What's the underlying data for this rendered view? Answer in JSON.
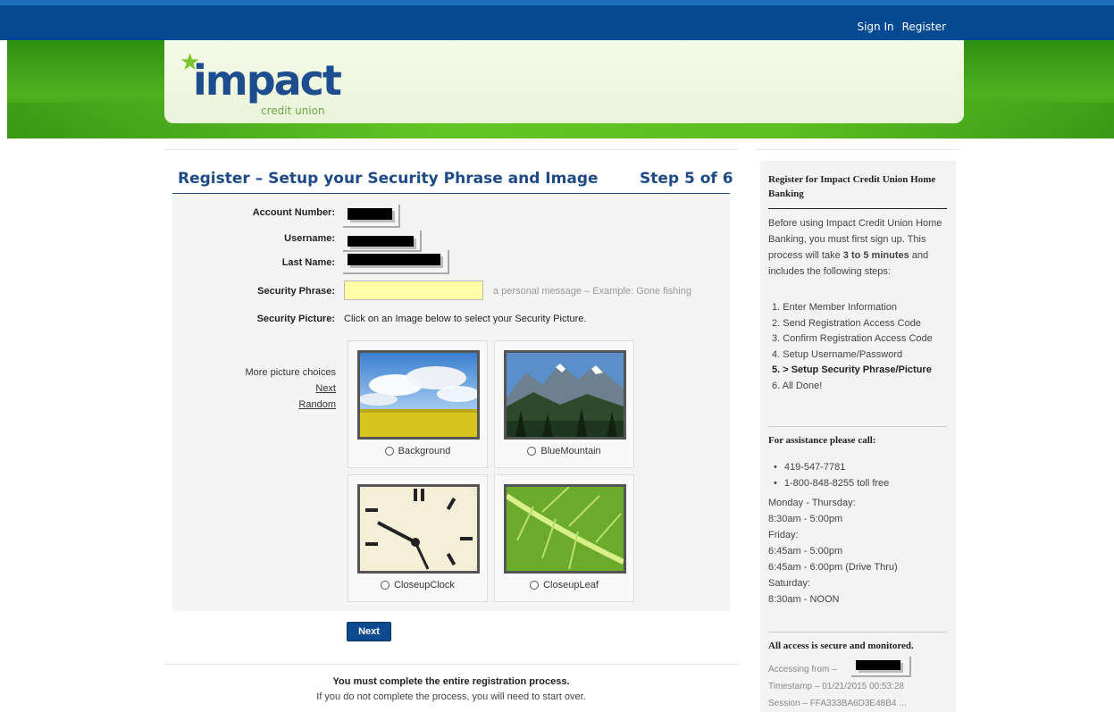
{
  "topnav": {
    "sign_in": "Sign In",
    "register": "Register"
  },
  "logo": {
    "main": "impact",
    "sub": "credit union"
  },
  "page": {
    "heading": "Register – Setup your Security Phrase and Image",
    "step": "Step 5 of 6"
  },
  "form": {
    "account_label": "Account Number:",
    "username_label": "Username:",
    "lastname_label": "Last Name:",
    "phrase_label": "Security Phrase:",
    "phrase_value": "",
    "phrase_hint": "a personal message – Example: Gone fishing",
    "picture_label": "Security Picture:",
    "picture_instruction": "Click on an Image below to select your Security Picture."
  },
  "more_choices": {
    "title": "More picture choices",
    "next": "Next",
    "random": "Random"
  },
  "pictures": [
    {
      "label": "Background"
    },
    {
      "label": "BlueMountain"
    },
    {
      "label": "CloseupClock"
    },
    {
      "label": "CloseupLeaf"
    }
  ],
  "next_button": "Next",
  "footer": {
    "bold": "You must complete the entire registration process.",
    "text": "If you do not complete the process, you will need to start over."
  },
  "sidebar": {
    "title": "Register for Impact Credit Union Home Banking",
    "intro_before": "Before using Impact Credit Union Home Banking, you must first sign up. This process will take ",
    "intro_bold": "3 to 5 minutes",
    "intro_after": " and includes the following steps:",
    "steps": [
      "1.  Enter Member Information",
      "2.  Send Registration Access Code",
      "3.  Confirm Registration Access Code",
      "4.  Setup Username/Password",
      "5.  > Setup Security Phrase/Picture",
      "6.  All Done!"
    ],
    "assist_title": "For assistance please call:",
    "phones": [
      "419-547-7781",
      "1-800-848-8255 toll free"
    ],
    "hours": [
      "Monday - Thursday:",
      "8:30am - 5:00pm",
      "Friday:",
      "6:45am - 5:00pm",
      "6:45am - 6:00pm (Drive Thru)",
      "Saturday:",
      "8:30am - NOON"
    ],
    "secure_title": "All access is secure and monitored.",
    "accessing_from": "Accessing from –",
    "timestamp": "Timestamp – 01/21/2015 00:53:28",
    "session": "Session – FFA333BA6D3E48B4 ..."
  }
}
